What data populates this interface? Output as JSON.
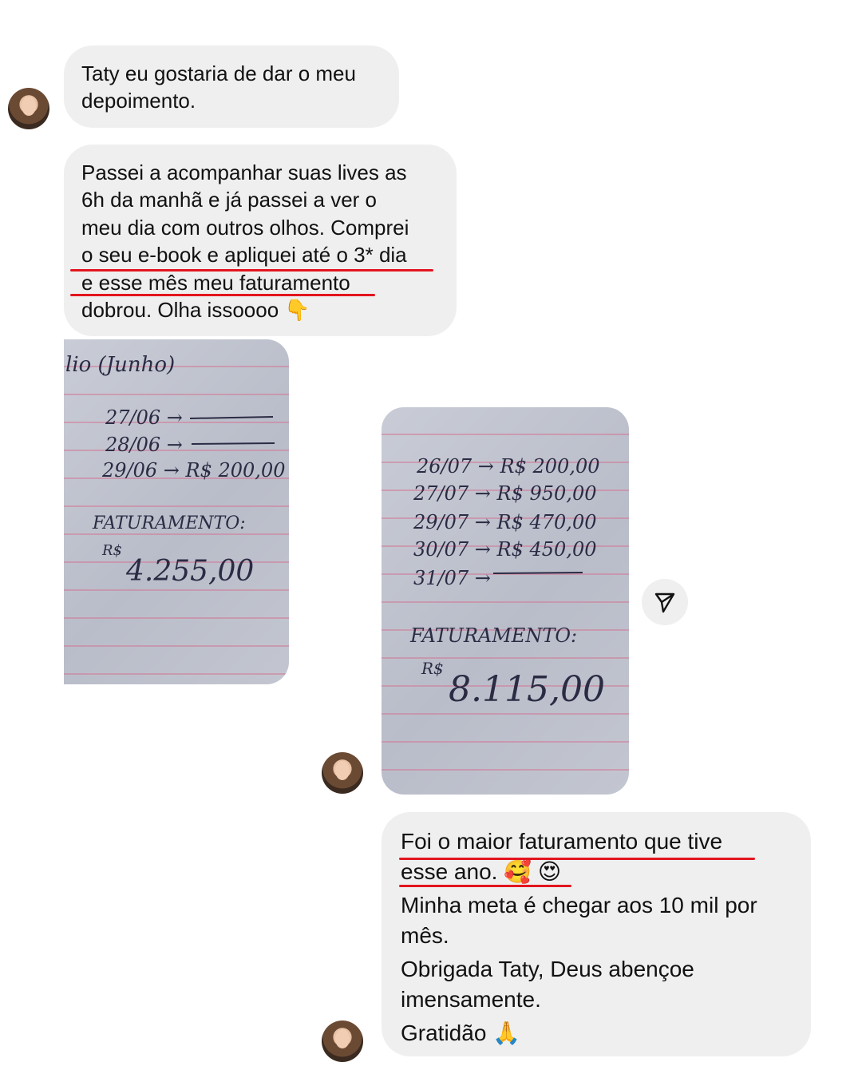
{
  "messages": {
    "m1": {
      "line1": "Taty eu gostaria de dar o meu",
      "line2": "depoimento."
    },
    "m2": {
      "line1": "Passei a acompanhar suas lives as",
      "line2": "6h da manhã e já passei a ver o",
      "line3": "meu dia com outros olhos. Comprei",
      "line4": "o seu e-book e apliquei até o 3* dia",
      "line5": "e esse mês meu faturamento",
      "line6": "dobrou. Olha issoooo 👇"
    },
    "m3": {
      "line1": "Foi o maior faturamento que tive",
      "line2": "esse ano. 🥰 😍",
      "line3": "Minha meta é chegar aos 10 mil por",
      "line4": "mês.",
      "line5": "Obrigada Taty, Deus abençoe",
      "line6": "imensamente.",
      "line7": "Gratidão 🙏"
    }
  },
  "photo1": {
    "header": "lio (Junho)",
    "rows": [
      "27/06 →",
      "28/06 →",
      "29/06 → R$ 200,00"
    ],
    "label": "FATURAMENTO:",
    "currency": "R$",
    "total": "4.255,00"
  },
  "photo2": {
    "rows": [
      "26/07 → R$ 200,00",
      "27/07 → R$ 950,00",
      "29/07 → R$ 470,00",
      "30/07 → R$ 450,00",
      "31/07 →"
    ],
    "label": "FATURAMENTO:",
    "currency": "R$",
    "total": "8.115,00"
  },
  "icons": {
    "share": "send-icon"
  },
  "colors": {
    "bubble": "#efefef",
    "underline": "#e3151e"
  }
}
